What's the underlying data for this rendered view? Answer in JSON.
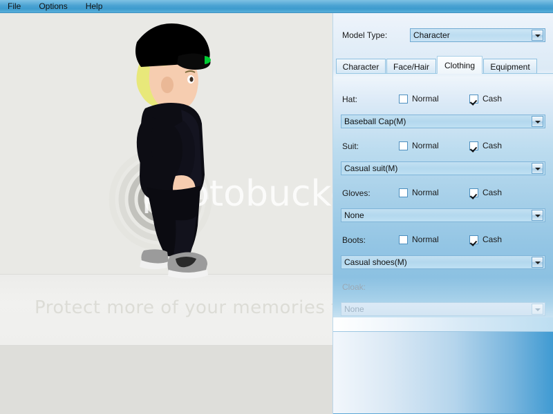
{
  "menu": {
    "items": [
      {
        "label": "File",
        "name": "menu-file"
      },
      {
        "label": "Options",
        "name": "menu-options"
      },
      {
        "label": "Help",
        "name": "menu-help"
      }
    ]
  },
  "viewport": {
    "watermark_logo_text": "photobucket",
    "watermark_tagline": "Protect more of your memories for less!",
    "background_color": "#e9e9e5",
    "floor_color": "#dededa"
  },
  "character": {
    "description": "3D avatar in side profile wearing black baseball cap, blonde hair, black suit jacket, black pants and grey sneakers",
    "colors": {
      "cap": "#000000",
      "cap_accent": "#00cc33",
      "hair": "#e8e87a",
      "skin": "#f6cdb0",
      "suit": "#0d0d14",
      "shoes": "#8f8f8f"
    }
  },
  "panel": {
    "model_type": {
      "label": "Model Type:",
      "value": "Character"
    },
    "tabs": [
      {
        "label": "Character",
        "active": false
      },
      {
        "label": "Face/Hair",
        "active": false
      },
      {
        "label": "Clothing",
        "active": true
      },
      {
        "label": "Equipment",
        "active": false
      }
    ],
    "checkbox_labels": {
      "normal": "Normal",
      "cash": "Cash"
    },
    "rows": [
      {
        "label": "Hat:",
        "normal_checked": false,
        "cash_checked": true,
        "value": "Baseball Cap(M)",
        "disabled": false
      },
      {
        "label": "Suit:",
        "normal_checked": false,
        "cash_checked": true,
        "value": "Casual suit(M)",
        "disabled": false
      },
      {
        "label": "Gloves:",
        "normal_checked": false,
        "cash_checked": true,
        "value": "None",
        "disabled": false
      },
      {
        "label": "Boots:",
        "normal_checked": false,
        "cash_checked": true,
        "value": "Casual shoes(M)",
        "disabled": false
      },
      {
        "label": "Cloak:",
        "normal_checked": false,
        "cash_checked": false,
        "value": "None",
        "disabled": true
      }
    ],
    "accent_color": "#4ba3d3"
  }
}
